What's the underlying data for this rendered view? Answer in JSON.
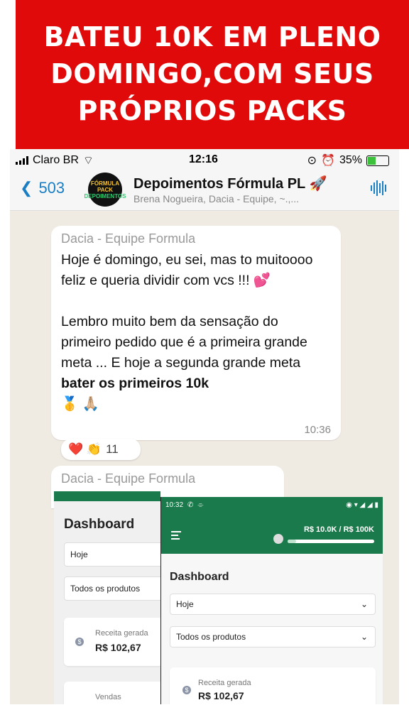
{
  "banner": {
    "line1": "BATEU 10K EM PLENO",
    "line2": "DOMINGO,COM SEUS",
    "line3": "PRÓPRIOS PACKS"
  },
  "status_bar": {
    "carrier": "Claro BR",
    "time": "12:16",
    "battery": "35%"
  },
  "chat_header": {
    "back_count": "503",
    "avatar_text": "FÓRMULA PACK",
    "avatar_sub": "DEPOIMENTOS",
    "title": "Depoimentos Fórmula PL 🚀",
    "subtitle": "Brena Nogueira, Dacia - Equipe, ~.,..."
  },
  "message1": {
    "sender": "Dacia - Equipe Formula",
    "para1": "Hoje é domingo, eu sei, mas to muitoooo feliz e queria dividir com vcs  !!! 💕",
    "para2_text": "Lembro muito bem da sensação do primeiro pedido que é a primeira grande meta ... E hoje a segunda grande meta ",
    "para2_bold": "bater os primeiros 10k",
    "para2_emoji": "🥇 🙏🏼",
    "time": "10:36",
    "reactions": "❤️ 👏",
    "reaction_count": "11"
  },
  "message2": {
    "sender": "Dacia - Equipe Formula"
  },
  "dashboard_left": {
    "title": "Dashboard",
    "period": "Hoje",
    "products": "Todos os produtos",
    "revenue_label": "Receita gerada",
    "revenue_value": "R$ 102,67",
    "sales_label": "Vendas"
  },
  "dashboard_right": {
    "status_time": "10:32",
    "goal_label": "R$ 10.0K / R$ 100K",
    "goal_progress": 0.1,
    "title": "Dashboard",
    "period": "Hoje",
    "products": "Todos os produtos",
    "revenue_label": "Receita gerada",
    "revenue_value": "R$ 102,67"
  },
  "colors": {
    "banner": "#e10a0a",
    "ios_blue": "#1a7ec4",
    "dashboard_green": "#1b7a4b"
  }
}
